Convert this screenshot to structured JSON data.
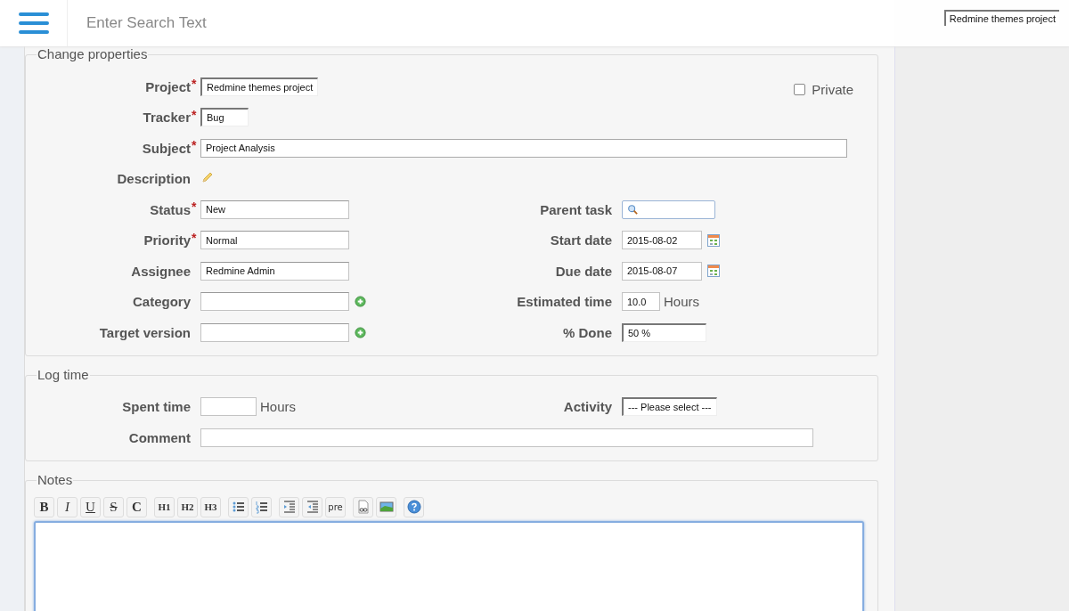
{
  "header": {
    "search_placeholder": "Enter Search Text",
    "project_select": "Redmine themes project"
  },
  "properties": {
    "legend": "Change properties",
    "private": {
      "label": "Private",
      "checked": false
    },
    "top": [
      {
        "label": "Project",
        "mark": "*",
        "kind": "select",
        "value": "Redmine themes project"
      },
      {
        "label": "Tracker",
        "mark": "*",
        "kind": "select-small",
        "value": "Bug"
      },
      {
        "label": "Subject",
        "mark": "*",
        "kind": "wide",
        "value": "Project Analysis"
      },
      {
        "label": "Description",
        "kind": "edit"
      }
    ],
    "left": [
      {
        "label": "Status",
        "mark": "*",
        "kind": "text",
        "value": "New"
      },
      {
        "label": "Priority",
        "mark": "*",
        "kind": "text",
        "value": "Normal"
      },
      {
        "label": "Assignee",
        "kind": "text",
        "value": "Redmine Admin"
      },
      {
        "label": "Category",
        "kind": "text-add"
      },
      {
        "label": "Target version",
        "kind": "text-add"
      }
    ],
    "right": [
      {
        "label": "Parent task",
        "kind": "search"
      },
      {
        "label": "Start date",
        "kind": "date",
        "value": "2015-08-02"
      },
      {
        "label": "Due date",
        "kind": "date",
        "value": "2015-08-07"
      },
      {
        "label": "Estimated time",
        "kind": "number",
        "value": "10.0",
        "suffix": "Hours"
      },
      {
        "label": "% Done",
        "kind": "select-mid",
        "value": "50 %"
      }
    ]
  },
  "log_time": {
    "legend": "Log time",
    "left": [
      {
        "label": "Spent time",
        "kind": "number-wide",
        "suffix": "Hours"
      }
    ],
    "right": [
      {
        "label": "Activity",
        "kind": "select",
        "value": "--- Please select ---"
      }
    ],
    "bottom": [
      {
        "label": "Comment",
        "kind": "comment"
      }
    ]
  },
  "notes": {
    "legend": "Notes",
    "toolbar": [
      [
        {
          "kind": "text",
          "label": "B"
        },
        {
          "kind": "text",
          "label": "I"
        },
        {
          "kind": "text",
          "label": "U"
        },
        {
          "kind": "text",
          "label": "S"
        },
        {
          "kind": "text",
          "label": "C"
        }
      ],
      [
        {
          "kind": "text",
          "label": "H1"
        },
        {
          "kind": "text",
          "label": "H2"
        },
        {
          "kind": "text",
          "label": "H3"
        }
      ],
      [
        {
          "kind": "ul"
        },
        {
          "kind": "ol"
        }
      ],
      [
        {
          "kind": "indent"
        },
        {
          "kind": "outdent"
        },
        {
          "kind": "text",
          "label": "pre"
        }
      ],
      [
        {
          "kind": "link"
        },
        {
          "kind": "image"
        }
      ],
      [
        {
          "kind": "help"
        }
      ]
    ]
  }
}
